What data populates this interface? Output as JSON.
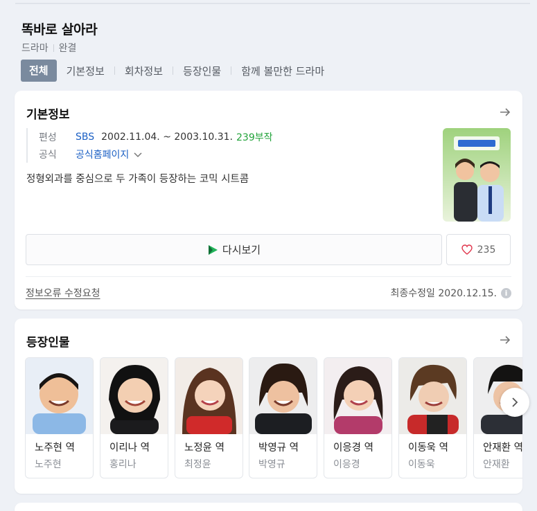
{
  "header": {
    "title": "똑바로 살아라",
    "genre": "드라마",
    "status": "완결"
  },
  "tabs": [
    {
      "label": "전체",
      "active": true
    },
    {
      "label": "기본정보"
    },
    {
      "label": "회차정보"
    },
    {
      "label": "등장인물"
    },
    {
      "label": "함께 볼만한 드라마"
    }
  ],
  "basic_info": {
    "section_title": "기본정보",
    "broadcast_label": "편성",
    "channel": "SBS",
    "period": "2002.11.04. ~ 2003.10.31.",
    "episodes": "239부작",
    "official_label": "공식",
    "official_link": "공식홈페이지",
    "description": "정형외과를 중심으로 두 가족이 등장하는 코믹 시트콤",
    "poster_icon": "drama-poster",
    "replay_label": "다시보기",
    "like_count": "235",
    "report_label": "정보오류 수정요청",
    "updated_label": "최종수정일 2020.12.15.",
    "info_icon_glyph": "i"
  },
  "cast": {
    "section_title": "등장인물",
    "items": [
      {
        "role": "노주현 역",
        "actor": "노주현"
      },
      {
        "role": "이리나 역",
        "actor": "홍리나"
      },
      {
        "role": "노정윤 역",
        "actor": "최정윤"
      },
      {
        "role": "박영규 역",
        "actor": "박영규"
      },
      {
        "role": "이응경 역",
        "actor": "이응경"
      },
      {
        "role": "이동욱 역",
        "actor": "이동욱"
      },
      {
        "role": "안재환 역",
        "actor": "안재환"
      }
    ]
  },
  "colors": {
    "accent_tab": "#7a8a9e",
    "link_blue": "#1a5fc4",
    "episodes_green": "#22a33a",
    "heart_red": "#e0344b"
  }
}
